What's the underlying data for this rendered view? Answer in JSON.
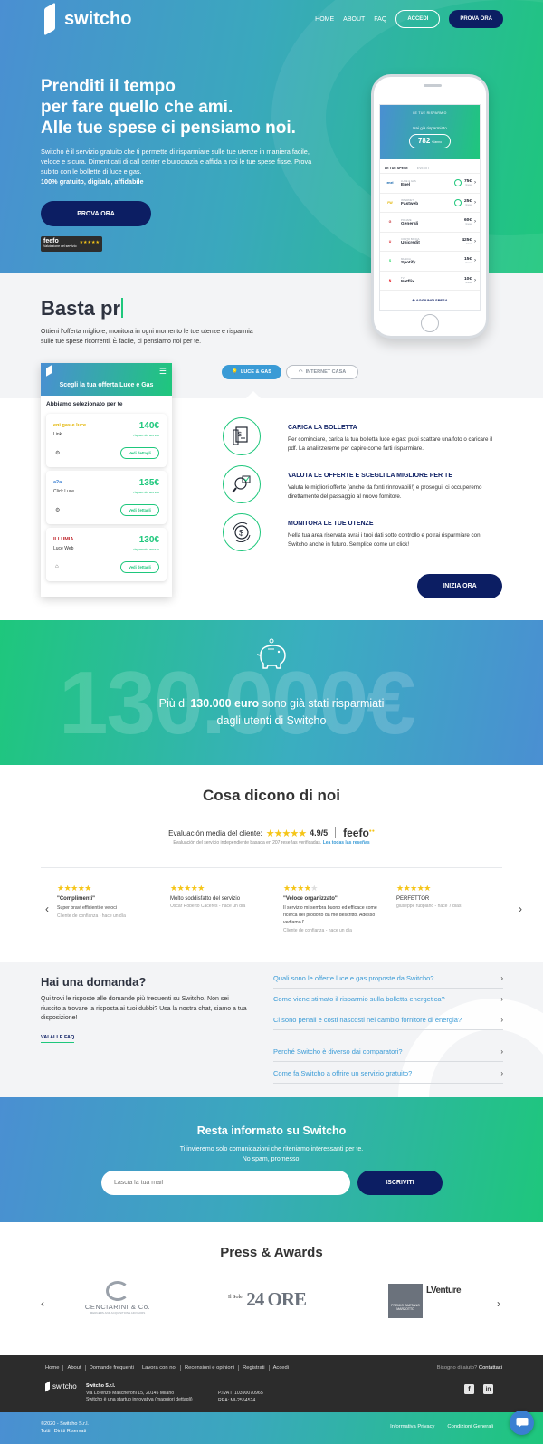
{
  "header": {
    "brand": "switcho",
    "nav": [
      "HOME",
      "ABOUT",
      "FAQ"
    ],
    "login_label": "ACCEDI",
    "try_label": "PROVA ORA"
  },
  "hero": {
    "title_lines": [
      "Prenditi il tempo",
      "per fare quello che ami.",
      "Alle tue spese ci pensiamo noi."
    ],
    "intro": "Switcho è il servizio gratuito che ti permette di risparmiare sulle tue utenze in maniera facile, veloce e sicura. Dimenticati di call center e burocrazia e affida a noi le tue spese fisse. Prova subito con le bollette di luce e gas.",
    "tagline": "100% gratuito, digitale, affidabile",
    "cta": "PROVA ORA",
    "feefo_badge": "feefo",
    "feefo_sub": "Valutazione del servizio"
  },
  "phone": {
    "top_label": "LE TUE RISPARMIO",
    "saved_label": "Hai già risparmiato",
    "saved_value": "782",
    "saved_unit": "€/anno",
    "tab_active": "LE TUE SPESE",
    "tab_other": "EVENTI",
    "rows": [
      {
        "logo": "enel",
        "small": "LUCE & GAS",
        "name": "Enel",
        "price": "75€",
        "unit": "/mese",
        "color": "#0a5ea8"
      },
      {
        "logo": "FW",
        "small": "INTERNET",
        "name": "Fastweb",
        "price": "25€",
        "unit": "/mese",
        "color": "#e2b400"
      },
      {
        "logo": "G",
        "small": "POLIZZE",
        "name": "Generali",
        "price": "60€",
        "unit": "/mese",
        "color": "#c0272d"
      },
      {
        "logo": "U",
        "small": "CONTO BANCA",
        "name": "Unicredit",
        "price": "425€",
        "unit": "/anno",
        "color": "#d71f26"
      },
      {
        "logo": "S",
        "small": "MUSICA",
        "name": "Spotify",
        "price": "15€",
        "unit": "/mese",
        "color": "#1ed760"
      },
      {
        "logo": "N",
        "small": "TV",
        "name": "Netflix",
        "price": "10€",
        "unit": "/mese",
        "color": "#e50914"
      }
    ],
    "add_label": "AGGIUNGI SPESA"
  },
  "basta": {
    "heading": "Basta pr",
    "text": "Ottieni l'offerta migliore, monitora in ogni momento le tue utenze e risparmia sulle tue spese ricorrenti. È facile, ci pensiamo noi per te."
  },
  "pills": {
    "active": "LUCE & GAS",
    "inactive": "INTERNET CASA"
  },
  "offer": {
    "title": "Scegli la tua offerta Luce e Gas",
    "subtitle": "Abbiamo selezionato per te",
    "cards": [
      {
        "brand": "eni gas e luce",
        "plan": "Link",
        "price": "140€",
        "caption": "risparmio annuo",
        "details": "Vedi dettagli",
        "color": "#e2b400"
      },
      {
        "brand": "a2a",
        "plan": "Click Luce",
        "price": "135€",
        "caption": "risparmio annuo",
        "details": "Vedi dettagli",
        "color": "#3a7fd2"
      },
      {
        "brand": "ILLUMIA",
        "plan": "Luce Web",
        "price": "130€",
        "caption": "risparmio annuo",
        "details": "Vedi dettagli",
        "color": "#c0272d"
      }
    ]
  },
  "steps": [
    {
      "title": "CARICA LA BOLLETTA",
      "text": "Per cominciare, carica la tua bolletta luce e gas: puoi scattare una foto o caricare il pdf. La analizzeremo per capire come farti risparmiare."
    },
    {
      "title": "VALUTA LE OFFERTE E SCEGLI LA MIGLIORE PER TE",
      "text": "Valuta le migliori offerte (anche da fonti rinnovabili!) e prosegui: ci occuperemo direttamente del passaggio al nuovo fornitore."
    },
    {
      "title": "MONITORA LE TUE UTENZE",
      "text": "Nella tua area riservata avrai i tuoi dati sotto controllo e potrai risparmiare con Switcho anche in futuro. Semplice come un click!"
    }
  ],
  "steps_cta": "INIZIA ORA",
  "savings": {
    "background_number": "130.000€",
    "msg_pre": "Più di ",
    "msg_bold": "130.000 euro",
    "msg_post": " sono già stati risparmiati",
    "msg_line2": "dagli utenti di Switcho"
  },
  "reviews": {
    "title": "Cosa dicono di noi",
    "avg_label": "Evaluación media del cliente:",
    "score": "4.9/5",
    "provider": "feefo",
    "sub_text": "Evaluación del servicio independiente basada en 207 reseñas verificadas.",
    "sub_link": "Lea todas las reseñas",
    "items": [
      {
        "stars": 5,
        "title": "\"Complimenti\"",
        "bold": true,
        "body": "Super bravi efficienti e veloci",
        "by": "Cliente de confianza - hace un día"
      },
      {
        "stars": 5,
        "title": "Molto soddisfatto del servizio",
        "bold": false,
        "body": "",
        "by": "Oscar Roberto Caceres - hace un día"
      },
      {
        "stars": 4,
        "title": "\"Veloce organizzato\"",
        "bold": true,
        "body": "Il servizio mi sembra buono ed efficace come ricerca del prodotto da me descritto. Adesso vediamo l'...",
        "by": "Cliente de confianza - hace un día"
      },
      {
        "stars": 5,
        "title": "PERFETTOR",
        "bold": false,
        "body": "",
        "by": "giuseppe rubplano - hace 7 días"
      }
    ]
  },
  "faq": {
    "title": "Hai una domanda?",
    "text": "Qui trovi le risposte alle domande più frequenti su Switcho. Non sei riuscito a trovare la risposta ai tuoi dubbi? Usa la nostra chat, siamo a tua disposizione!",
    "link": "VAI ALLE FAQ",
    "questions": [
      "Quali sono le offerte luce e gas proposte da Switcho?",
      "Come viene stimato il risparmio sulla bolletta energetica?",
      "Ci sono penali e costi nascosti nel cambio fornitore di energia?",
      "Perché Switcho è diverso dai comparatori?",
      "Come fa Switcho a offrire un servizio gratuito?"
    ]
  },
  "newsletter": {
    "title": "Resta informato su Switcho",
    "line1": "Ti invieremo solo comunicazioni che riteniamo interessanti per te.",
    "line2": "No spam, promesso!",
    "placeholder": "Lascia la tua mail",
    "button": "ISCRIVITI"
  },
  "press": {
    "title": "Press & Awards",
    "logos": [
      {
        "main": "CENCIARINI & Co.",
        "sub": "MERGERS AND ACQUISITIONS ADVISORS"
      },
      {
        "main": "24 ORE",
        "sub": "Il Sole"
      },
      {
        "main": "LVenture",
        "sub": "PREMIO GAETANO MARZOTTO"
      }
    ]
  },
  "footer": {
    "links": [
      "Home",
      "About",
      "Domande frequenti",
      "Lavora con noi",
      "Recensioni e opinioni",
      "Registrati",
      "Accedi"
    ],
    "help_text": "Bisogno di aiuto?",
    "help_link": "Contattaci",
    "brand": "switcho",
    "company": "Switcho S.r.l.",
    "address": "Via Lorenzo Mascheroni 15, 20145 Milano",
    "startup": "Switcho è una startup innovativa (maggiori dettagli)",
    "iva": "P.IVA IT10390070965",
    "rea": "REA: MI-2554524",
    "copyright": "©2020 - Switcho S.r.l.",
    "rights": "Tutti i Diritti Riservati",
    "privacy": "Informativa Privacy",
    "conditions": "Condizioni Generali"
  }
}
